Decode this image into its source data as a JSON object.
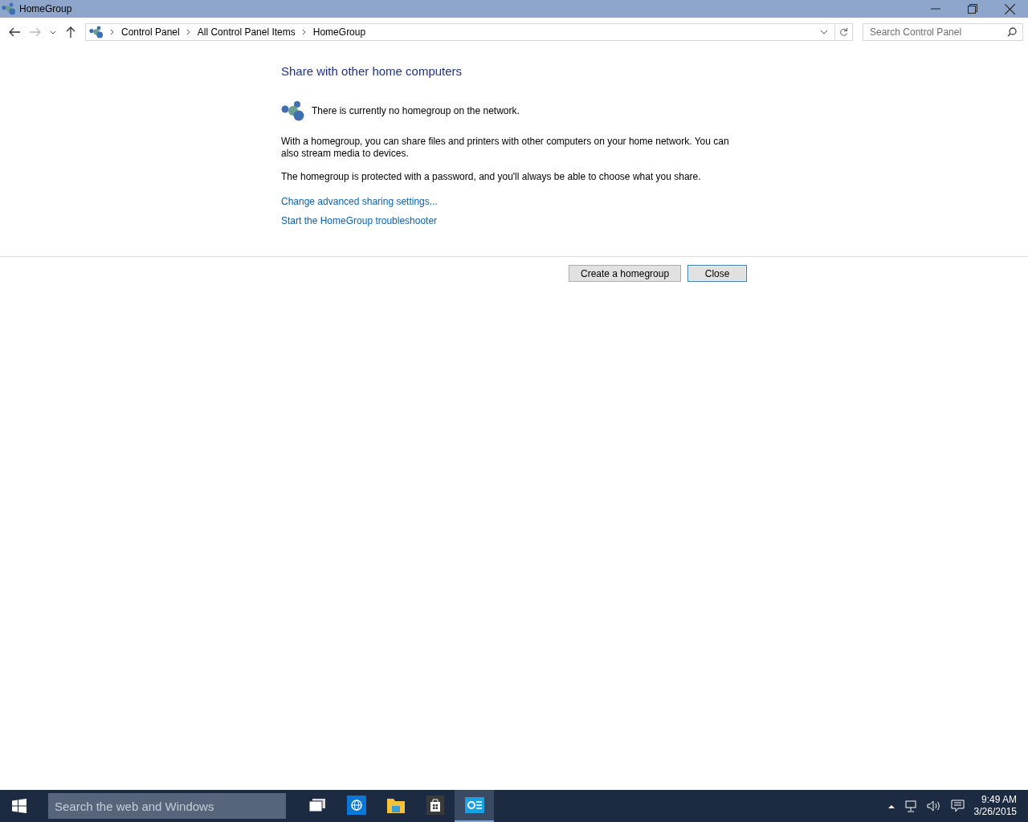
{
  "window": {
    "title": "HomeGroup"
  },
  "address_bar": {
    "breadcrumbs": [
      "Control Panel",
      "All Control Panel Items",
      "HomeGroup"
    ]
  },
  "search": {
    "placeholder": "Search Control Panel"
  },
  "content": {
    "heading": "Share with other home computers",
    "status": "There is currently no homegroup on the network.",
    "paragraphs": [
      "With a homegroup, you can share files and printers with other computers on your home network. You can also stream media to devices.",
      "The homegroup is protected with a password, and you'll always be able to choose what you share."
    ],
    "links": [
      "Change advanced sharing settings...",
      "Start the HomeGroup troubleshooter"
    ]
  },
  "buttons": [
    {
      "label": "Create a homegroup",
      "selected": false
    },
    {
      "label": "Close",
      "selected": true
    }
  ],
  "taskbar": {
    "search_placeholder": "Search the web and Windows",
    "apps": [
      {
        "kind": "taskview",
        "selected": false
      },
      {
        "kind": "browser",
        "selected": false
      },
      {
        "kind": "explorer",
        "selected": false
      },
      {
        "kind": "store",
        "selected": false
      },
      {
        "kind": "controlpanel",
        "selected": true
      }
    ],
    "time": "9:49 AM",
    "date": "3/26/2015"
  }
}
